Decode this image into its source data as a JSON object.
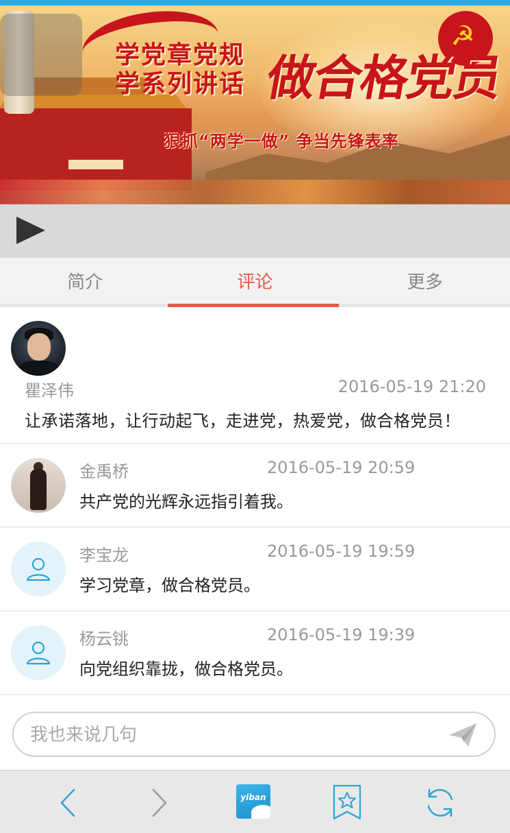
{
  "banner": {
    "headline_line1": "学党章党规",
    "headline_line2": "学系列讲话",
    "big_title": "做合格党员",
    "slogan": "狠抓“两学一做” 争当先锋表率"
  },
  "tabs": [
    {
      "label": "简介",
      "active": false
    },
    {
      "label": "评论",
      "active": true
    },
    {
      "label": "更多",
      "active": false
    }
  ],
  "comments": [
    {
      "name": "瞿泽伟",
      "time": "2016-05-19 21:20",
      "text": "让承诺落地，让行动起飞，走进党，热爱党，做合格党员！",
      "avatar": "photo"
    },
    {
      "name": "金禹桥",
      "time": "2016-05-19 20:59",
      "text": "共产党的光辉永远指引着我。",
      "avatar": "photo"
    },
    {
      "name": "李宝龙",
      "time": "2016-05-19 19:59",
      "text": "学习党章，做合格党员。",
      "avatar": "default-user-icon"
    },
    {
      "name": "杨云铫",
      "time": "2016-05-19 19:39",
      "text": "向党组织靠拢，做合格党员。",
      "avatar": "default-user-icon"
    }
  ],
  "comment_input": {
    "placeholder": "我也来说几句",
    "value": ""
  },
  "navbar": {
    "items": [
      "back-icon",
      "forward-icon",
      "yiban-app-icon",
      "bookmark-star-icon",
      "refresh-icon"
    ],
    "yiban_label": "yiban"
  },
  "colors": {
    "accent": "#e8584b",
    "top_bar": "#29a8e8",
    "icon_blue": "#2aa3d8"
  }
}
